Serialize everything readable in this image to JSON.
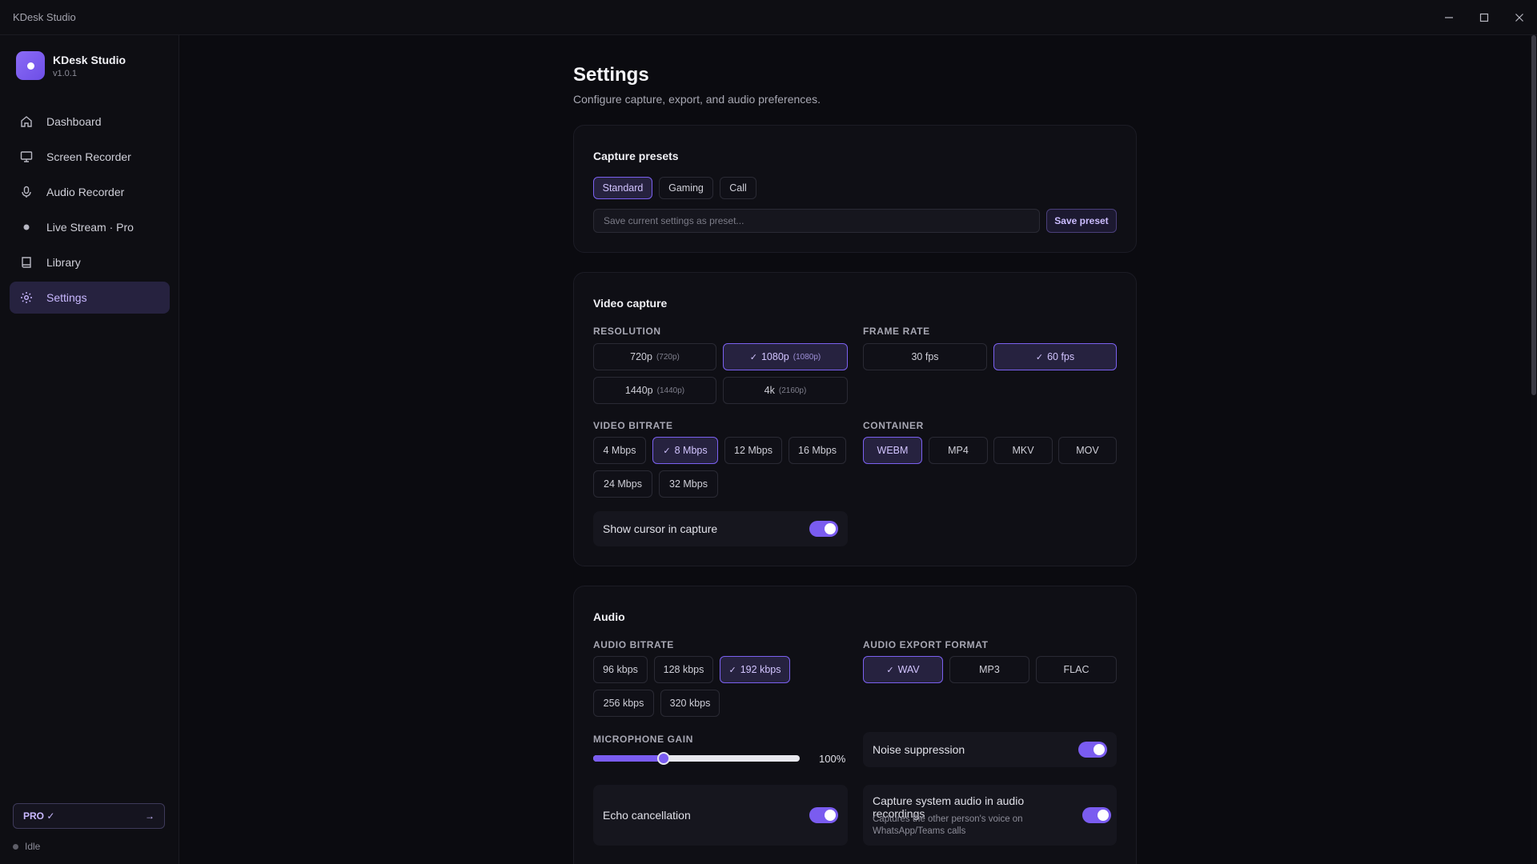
{
  "window": {
    "title": "KDesk Studio"
  },
  "brand": {
    "name": "KDesk Studio",
    "version": "v1.0.1"
  },
  "sidebar": {
    "items": [
      {
        "label": "Dashboard",
        "icon": "home-icon"
      },
      {
        "label": "Screen Recorder",
        "icon": "monitor-icon"
      },
      {
        "label": "Audio Recorder",
        "icon": "microphone-icon"
      },
      {
        "label": "Live Stream · Pro",
        "icon": "dot-icon"
      },
      {
        "label": "Library",
        "icon": "book-icon"
      },
      {
        "label": "Settings",
        "icon": "gear-icon",
        "active": true
      }
    ],
    "pro_label": "PRO ✓",
    "pro_arrow": "→",
    "status": "Idle"
  },
  "page": {
    "title": "Settings",
    "subtitle": "Configure capture, export, and audio preferences."
  },
  "presets": {
    "title": "Capture presets",
    "options": [
      "Standard",
      "Gaming",
      "Call"
    ],
    "selected": "Standard",
    "input_placeholder": "Save current settings as preset...",
    "save_label": "Save preset"
  },
  "video": {
    "title": "Video capture",
    "resolution_label": "RESOLUTION",
    "resolutions": [
      {
        "label": "720p",
        "sub": "(720p)"
      },
      {
        "label": "1080p",
        "sub": "(1080p)",
        "selected": true
      },
      {
        "label": "1440p",
        "sub": "(1440p)"
      },
      {
        "label": "4k",
        "sub": "(2160p)"
      }
    ],
    "framerate_label": "FRAME RATE",
    "framerates": [
      {
        "label": "30 fps"
      },
      {
        "label": "60 fps",
        "selected": true
      }
    ],
    "bitrate_label": "VIDEO BITRATE",
    "bitrates": [
      "4 Mbps",
      "8 Mbps",
      "12 Mbps",
      "16 Mbps",
      "24 Mbps",
      "32 Mbps"
    ],
    "bitrate_selected": "8 Mbps",
    "container_label": "CONTAINER",
    "containers": [
      "WEBM",
      "MP4",
      "MKV",
      "MOV"
    ],
    "container_selected": "WEBM",
    "show_cursor_label": "Show cursor in capture",
    "show_cursor_on": true
  },
  "audio": {
    "title": "Audio",
    "bitrate_label": "AUDIO BITRATE",
    "bitrates": [
      "96 kbps",
      "128 kbps",
      "192 kbps",
      "256 kbps",
      "320 kbps"
    ],
    "bitrate_selected": "192 kbps",
    "format_label": "AUDIO EXPORT FORMAT",
    "formats": [
      "WAV",
      "MP3",
      "FLAC"
    ],
    "format_selected": "WAV",
    "gain_label": "MICROPHONE GAIN",
    "gain_value": "100%",
    "gain_level": 0.34,
    "noise_label": "Noise suppression",
    "echo_label": "Echo cancellation",
    "system_audio_label": "Capture system audio in audio recordings",
    "system_audio_desc": "Captures the other person's voice on WhatsApp/Teams calls"
  },
  "colors": {
    "accent": "#7a5cf0",
    "accent_bg": "#26223f",
    "background": "#0b0b10"
  }
}
